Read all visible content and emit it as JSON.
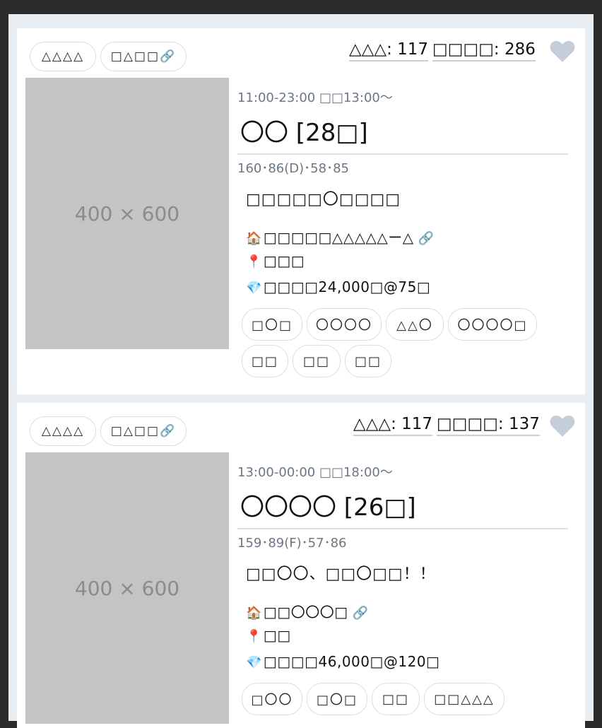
{
  "cards": [
    {
      "tag1": "△△△△",
      "tag2": "□△□□🔗",
      "stat1": "△△△: 117",
      "stat2": "□□□□: 286",
      "photo_label": "400 × 600",
      "hours": "11:00-23:00  □□13:00〜",
      "name": "〇〇 [28□]",
      "measure": "160･86(D)･58･85",
      "comment": "□□□□□〇□□□□",
      "shop": "□□□□□△△△△△ー△",
      "area": "□□□",
      "price": "□□□□24,000□@75□",
      "chips": [
        "□〇□",
        "〇〇〇〇",
        "△△〇",
        "〇〇〇〇□",
        "□□",
        "□□",
        "□□"
      ]
    },
    {
      "tag1": "△△△△",
      "tag2": "□△□□🔗",
      "stat1": "△△△: 117",
      "stat2": "□□□□: 137",
      "photo_label": "400 × 600",
      "hours": "13:00-00:00  □□18:00〜",
      "name": "〇〇〇〇 [26□]",
      "measure": "159･89(F)･57･86",
      "comment": "□□〇〇、□□〇□□！！",
      "shop": "□□〇〇〇□",
      "area": "□□",
      "price": "□□□□46,000□@120□",
      "chips": [
        "□〇〇",
        "□〇□",
        "□□",
        "□□△△△"
      ]
    }
  ],
  "icons": {
    "home": "house-icon",
    "pin": "pin-icon",
    "gem": "gem-icon",
    "link": "link-icon",
    "heart": "heart-icon"
  },
  "colors": {
    "heart": "#c5ced8",
    "muted_text": "#6b7785",
    "photo_bg": "#c4c4c4",
    "page_bg": "#e9eef3"
  }
}
